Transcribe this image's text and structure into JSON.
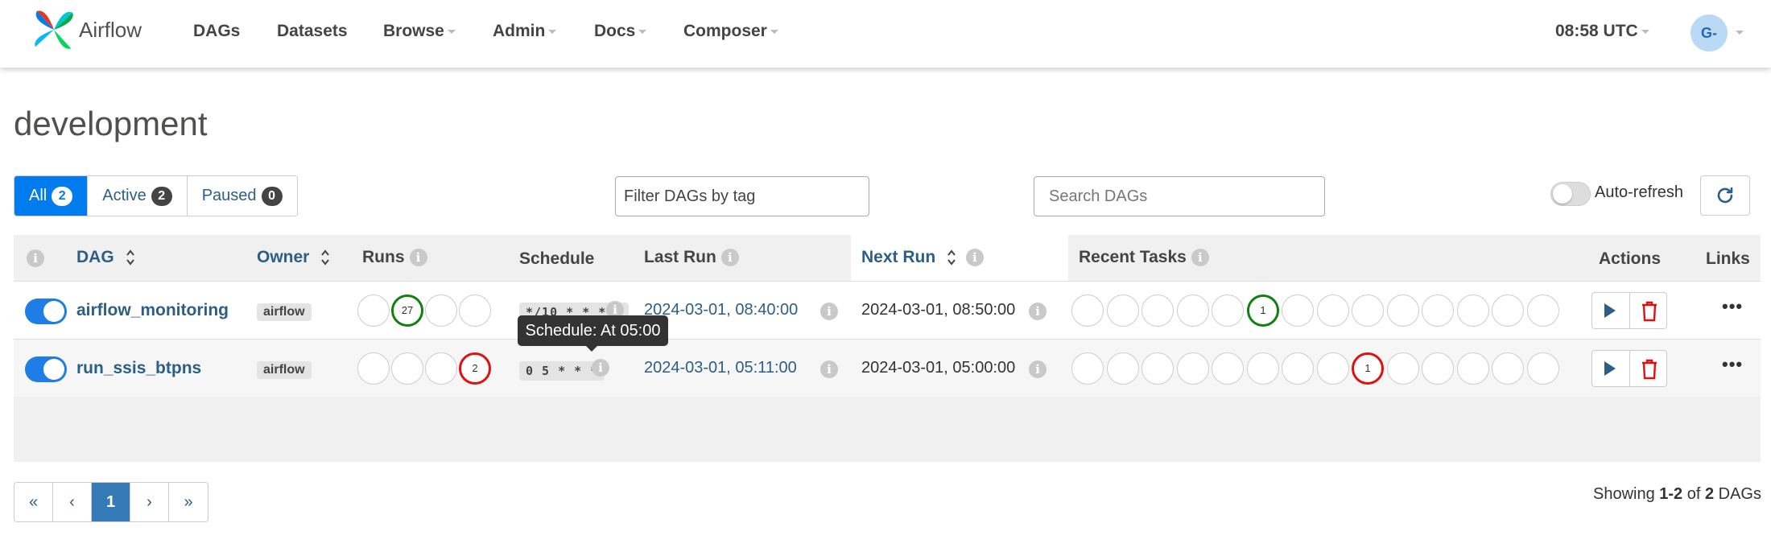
{
  "navbar": {
    "brand": "Airflow",
    "items": [
      {
        "label": "DAGs",
        "dropdown": false
      },
      {
        "label": "Datasets",
        "dropdown": false
      },
      {
        "label": "Browse",
        "dropdown": true
      },
      {
        "label": "Admin",
        "dropdown": true
      },
      {
        "label": "Docs",
        "dropdown": true
      },
      {
        "label": "Composer",
        "dropdown": true
      }
    ],
    "time": "08:58 UTC",
    "avatar": "G-"
  },
  "page": {
    "title": "development"
  },
  "filters": {
    "status": [
      {
        "label": "All",
        "count": "2"
      },
      {
        "label": "Active",
        "count": "2"
      },
      {
        "label": "Paused",
        "count": "0"
      }
    ],
    "tag_placeholder": "Filter DAGs by tag",
    "search_placeholder": "Search DAGs",
    "autorefresh_label": "Auto-refresh"
  },
  "table": {
    "headers": {
      "dag": "DAG",
      "owner": "Owner",
      "runs": "Runs",
      "schedule": "Schedule",
      "last_run": "Last Run",
      "next_run": "Next Run",
      "recent_tasks": "Recent Tasks",
      "actions": "Actions",
      "links": "Links"
    },
    "rows": [
      {
        "name": "airflow_monitoring",
        "owner": "airflow",
        "active": true,
        "runs": [
          "",
          "27",
          "",
          ""
        ],
        "schedule": "*/10 * * * *",
        "last_run": "2024-03-01, 08:40:00",
        "next_run": "2024-03-01, 08:50:00",
        "recent_tasks_marked": "1"
      },
      {
        "name": "run_ssis_btpns",
        "owner": "airflow",
        "active": true,
        "runs": [
          "",
          "",
          "",
          "2"
        ],
        "schedule": "0 5 * * *",
        "last_run": "2024-03-01, 05:11:00",
        "next_run": "2024-03-01, 05:00:00",
        "recent_tasks_marked": "1"
      }
    ],
    "links_icon": "ellipsis-icon"
  },
  "tooltip": "Schedule: At 05:00",
  "pagination": {
    "first": "«",
    "prev": "‹",
    "current": "1",
    "next": "›",
    "last": "»"
  },
  "footer": {
    "showing_prefix": "Showing ",
    "range": "1-2",
    "of": " of ",
    "total": "2",
    "suffix": " DAGs"
  },
  "colors": {
    "primary": "#017cee",
    "link": "#2c5e86",
    "success": "#108010",
    "failed": "#e01010"
  }
}
